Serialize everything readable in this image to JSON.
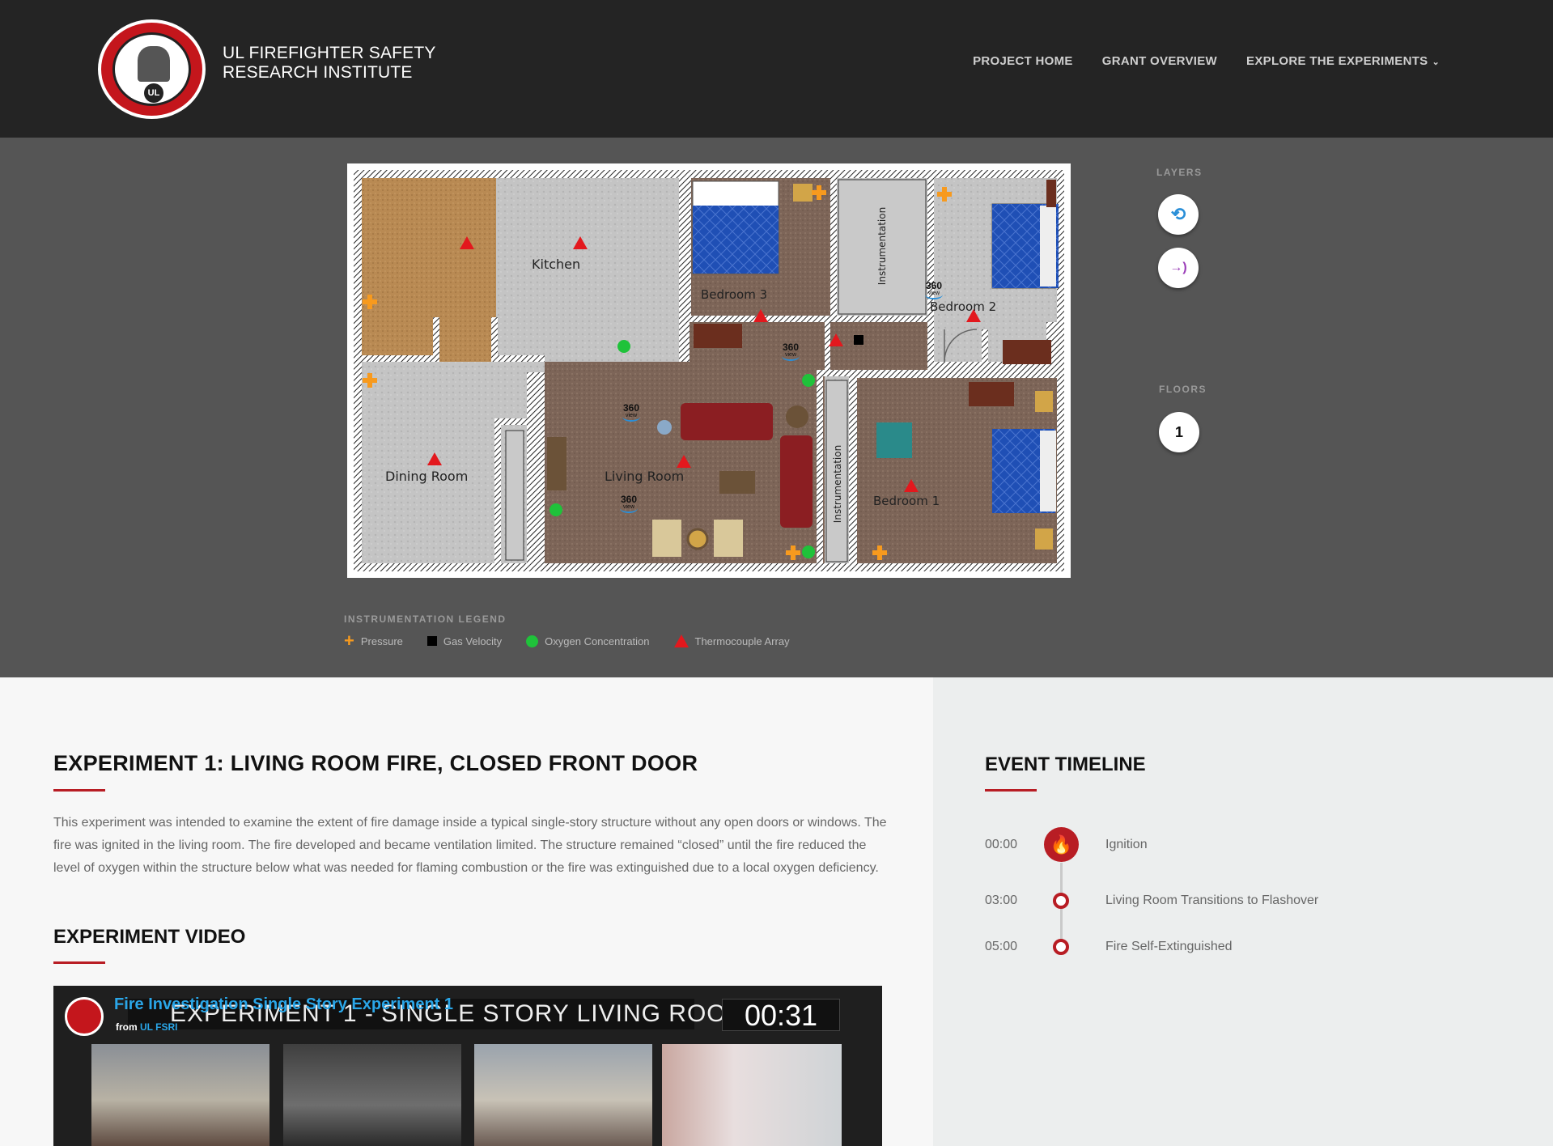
{
  "header": {
    "brand_line1": "UL FIREFIGHTER SAFETY",
    "brand_line2": "RESEARCH INSTITUTE",
    "nav": {
      "project_home": "PROJECT HOME",
      "grant_overview": "GRANT OVERVIEW",
      "explore": "EXPLORE THE EXPERIMENTS"
    }
  },
  "floorplan": {
    "rooms": {
      "kitchen": "Kitchen",
      "bedroom3": "Bedroom 3",
      "bedroom2": "Bedroom 2",
      "bedroom1": "Bedroom 1",
      "dining": "Dining Room",
      "living": "Living Room",
      "instr_top": "Instrumentation",
      "instr_bottom": "Instrumentation"
    },
    "badge_360": "360",
    "badge_view": "view"
  },
  "layers": {
    "title": "LAYERS"
  },
  "floors": {
    "title": "FLOORS",
    "current": "1"
  },
  "legend": {
    "title": "INSTRUMENTATION LEGEND",
    "pressure": "Pressure",
    "gas_velocity": "Gas Velocity",
    "oxygen": "Oxygen Concentration",
    "thermocouple": "Thermocouple Array",
    "colors": {
      "pressure": "#f79a1e",
      "gas_velocity": "#000000",
      "oxygen": "#1fc23a",
      "thermocouple": "#e3181d"
    }
  },
  "experiment": {
    "title": "EXPERIMENT 1: LIVING ROOM FIRE, CLOSED FRONT DOOR",
    "description": "This experiment was intended to examine the extent of fire damage inside a typical single-story structure without any open doors or windows. The fire was ignited in the living room. The fire developed and became ventilation limited. The structure remained “closed” until the fire reduced the level of oxygen within the structure below what was needed for flaming combustion or the fire was extinguished due to a local oxygen deficiency.",
    "video_heading": "EXPERIMENT VIDEO"
  },
  "video": {
    "title": "Fire Investigation Single Story Experiment 1",
    "from_prefix": "from",
    "from_channel": "UL FSRI",
    "banner": "EXPERIMENT 1 - SINGLE STORY LIVING ROOM",
    "clock": "00:31"
  },
  "timeline": {
    "title": "EVENT TIMELINE",
    "events": [
      {
        "time": "00:00",
        "label": "Ignition"
      },
      {
        "time": "03:00",
        "label": "Living Room Transitions to Flashover"
      },
      {
        "time": "05:00",
        "label": "Fire Self-Extinguished"
      }
    ]
  },
  "accent_color": "#b81d24"
}
